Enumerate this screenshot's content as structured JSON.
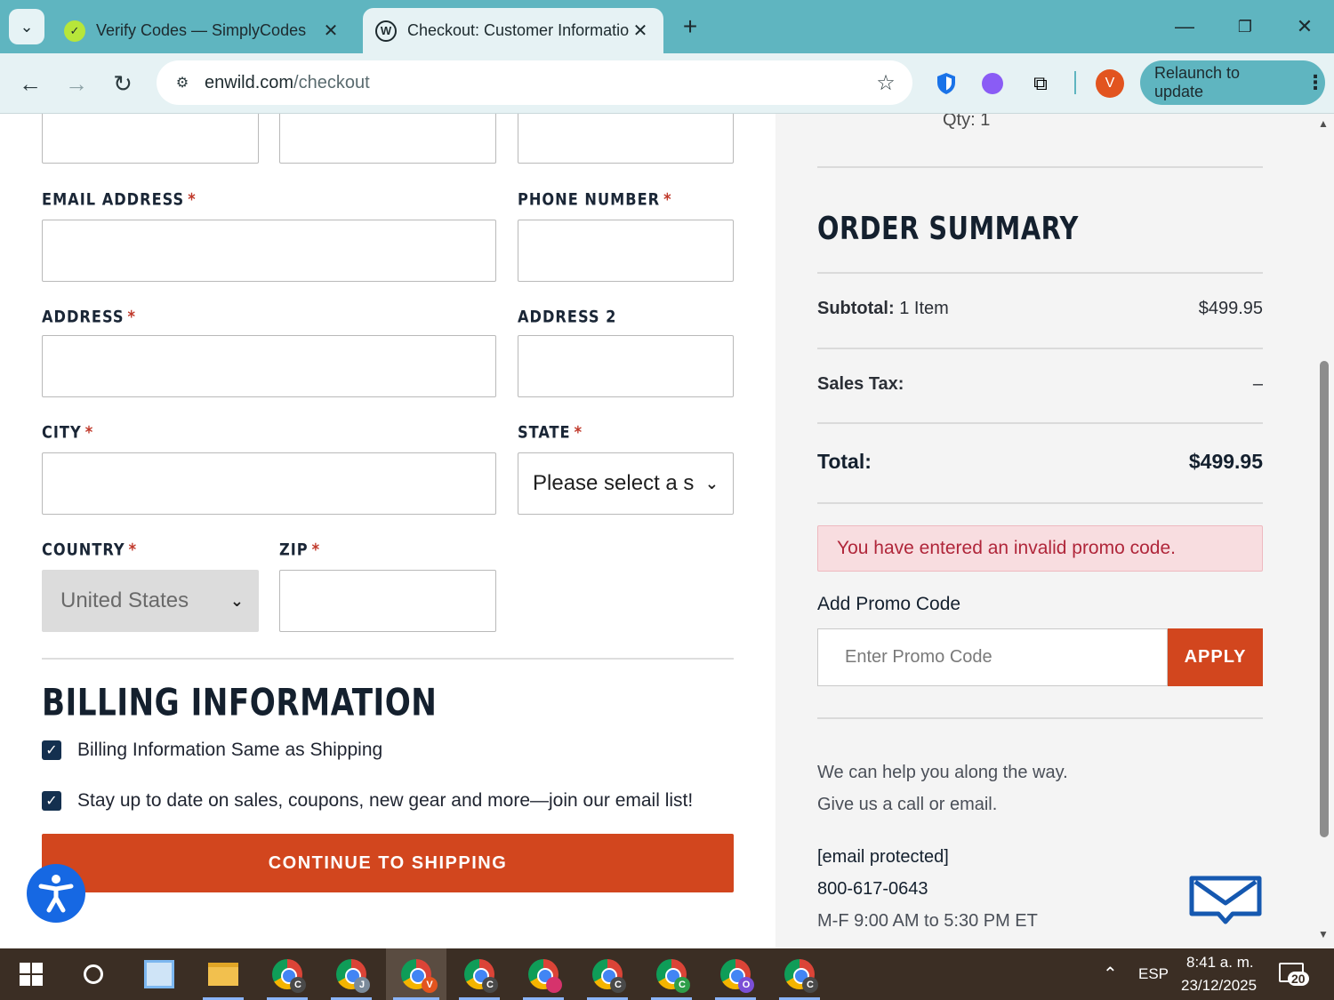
{
  "browser": {
    "tabs": [
      {
        "title": "Verify Codes — SimplyCodes",
        "favicon": "simplycodes-icon",
        "active": false
      },
      {
        "title": "Checkout: Customer Informatio",
        "favicon": "wordpress-icon",
        "active": true
      }
    ],
    "url_host": "enwild.com",
    "url_path": "/checkout",
    "relaunch_label": "Relaunch to update",
    "profile_initial": "V"
  },
  "form": {
    "email_label": "EMAIL ADDRESS",
    "phone_label": "PHONE NUMBER",
    "address_label": "ADDRESS",
    "address2_label": "ADDRESS 2",
    "city_label": "CITY",
    "state_label": "STATE",
    "state_value": "Please select a s",
    "country_label": "COUNTRY",
    "country_value": "United States",
    "zip_label": "ZIP",
    "required_mark": "*"
  },
  "billing": {
    "title": "BILLING INFORMATION",
    "same_as_shipping": "Billing Information Same as Shipping",
    "email_list": "Stay up to date on sales, coupons, new gear and more—join our email list!",
    "continue_label": "CONTINUE TO SHIPPING"
  },
  "summary": {
    "qty": "Qty: 1",
    "title": "ORDER SUMMARY",
    "subtotal_key": "Subtotal:",
    "subtotal_items": " 1 Item",
    "subtotal_value": "$499.95",
    "tax_key": "Sales Tax:",
    "tax_value": "–",
    "total_key": "Total:",
    "total_value": "$499.95",
    "error": "You have entered an invalid promo code.",
    "promo_label": "Add Promo Code",
    "promo_placeholder": "Enter Promo Code",
    "apply_label": "APPLY",
    "help_line1": "We can help you along the way.",
    "help_line2": "Give us a call or email.",
    "email": "[email protected]",
    "phone": "800-617-0643",
    "hours": "M-F 9:00 AM to 5:30 PM ET"
  },
  "taskbar": {
    "lang": "ESP",
    "time": "8:41 a. m.",
    "date": "23/12/2025",
    "notifications": "20",
    "chrome_badges": [
      "C",
      "J",
      "V",
      "C",
      "",
      "C",
      "C",
      "O",
      "C"
    ]
  },
  "colors": {
    "accent": "#d2461e",
    "navy": "#14304f",
    "error_bg": "#f8dde0",
    "chrome_teal": "#5fb5c0"
  }
}
